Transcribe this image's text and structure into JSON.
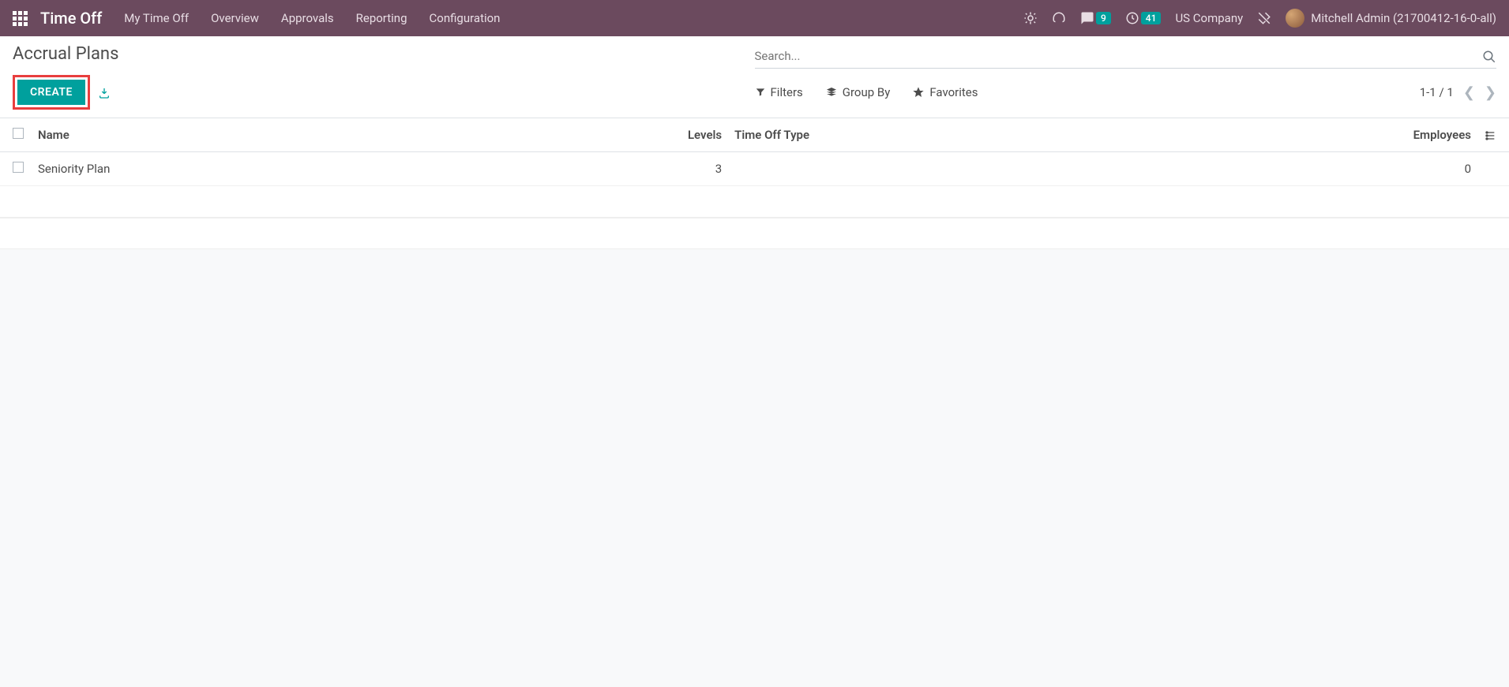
{
  "navbar": {
    "brand": "Time Off",
    "links": [
      "My Time Off",
      "Overview",
      "Approvals",
      "Reporting",
      "Configuration"
    ],
    "messages_badge": "9",
    "activities_badge": "41",
    "company": "US Company",
    "user": "Mitchell Admin (21700412-16-0-all)"
  },
  "control": {
    "title": "Accrual Plans",
    "create": "CREATE",
    "search_placeholder": "Search...",
    "filters": "Filters",
    "groupby": "Group By",
    "favorites": "Favorites",
    "pager": "1-1 / 1"
  },
  "table": {
    "headers": {
      "name": "Name",
      "levels": "Levels",
      "type": "Time Off Type",
      "employees": "Employees"
    },
    "rows": [
      {
        "name": "Seniority Plan",
        "levels": "3",
        "type": "",
        "employees": "0"
      }
    ]
  }
}
